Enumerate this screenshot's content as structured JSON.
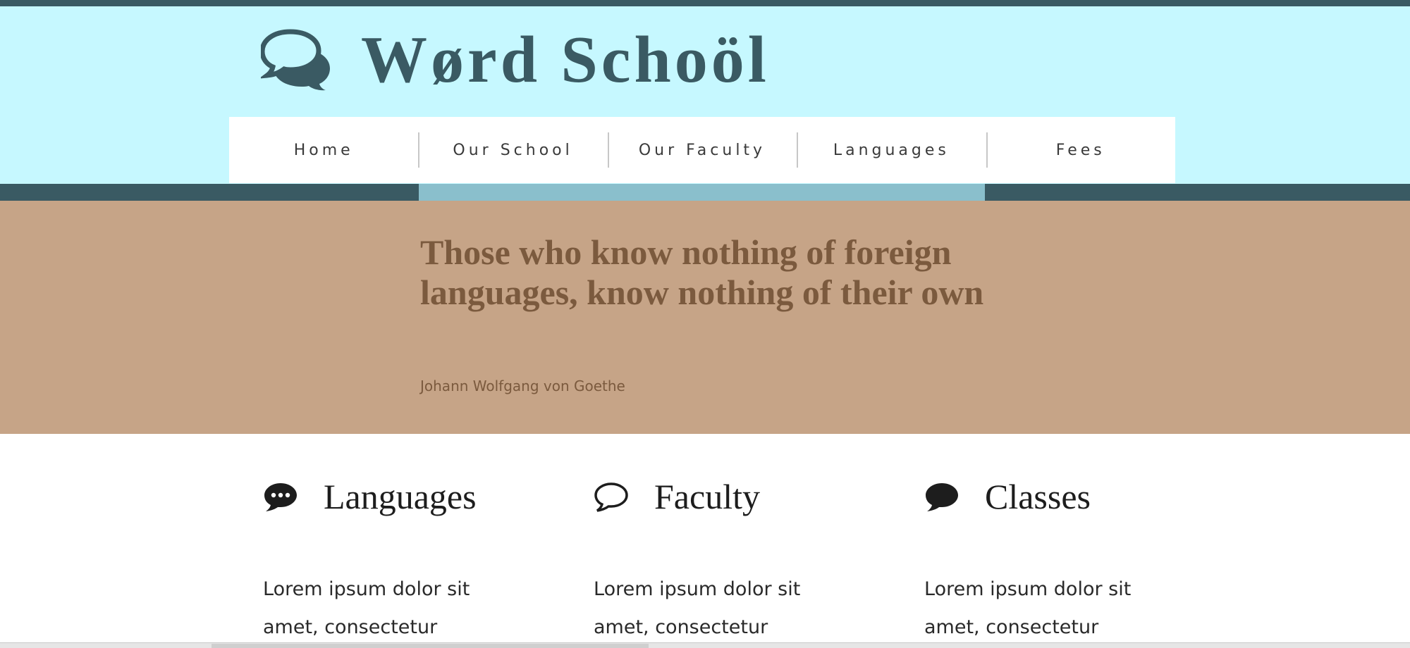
{
  "header": {
    "site_title": "Wørd Schoöl",
    "logo_icon": "speech-bubbles-icon"
  },
  "nav": {
    "items": [
      {
        "label": "Home"
      },
      {
        "label": "Our School"
      },
      {
        "label": "Our Faculty"
      },
      {
        "label": "Languages"
      },
      {
        "label": "Fees"
      }
    ]
  },
  "quote": {
    "text": "Those who know nothing of foreign languages, know nothing of their own",
    "author": "Johann Wolfgang von Goethe"
  },
  "features": [
    {
      "title": "Languages",
      "icon": "speech-bubble-dots-icon",
      "body": "Lorem ipsum dolor sit amet, consectetur"
    },
    {
      "title": "Faculty",
      "icon": "speech-bubble-outline-icon",
      "body": "Lorem ipsum dolor sit amet, consectetur"
    },
    {
      "title": "Classes",
      "icon": "speech-bubble-filled-icon",
      "body": "Lorem ipsum dolor sit amet, consectetur"
    }
  ],
  "colors": {
    "header_bg": "#c6f8ff",
    "brand_dark": "#3a5a63",
    "active_nav": "#8abfcc",
    "quote_bg": "#c6a487",
    "quote_text": "#7b5a3e"
  }
}
